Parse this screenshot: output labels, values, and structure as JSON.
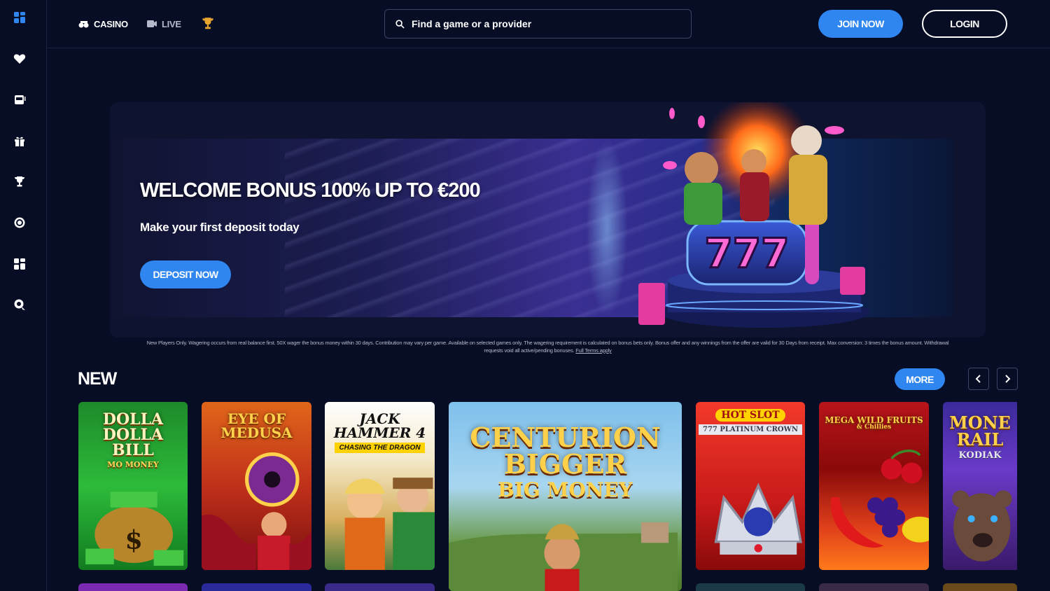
{
  "sidebar": {
    "items": [
      {
        "name": "sidebar-item-lobby",
        "icon": "grid-icon"
      },
      {
        "name": "sidebar-item-favorites",
        "icon": "heart-icon"
      },
      {
        "name": "sidebar-item-slots",
        "icon": "slot-machine-icon"
      },
      {
        "name": "sidebar-item-promotions",
        "icon": "gift-icon"
      },
      {
        "name": "sidebar-item-tournaments",
        "icon": "trophy-icon"
      },
      {
        "name": "sidebar-item-roulette",
        "icon": "roulette-icon"
      },
      {
        "name": "sidebar-item-categories",
        "icon": "grid-icon"
      },
      {
        "name": "sidebar-item-support",
        "icon": "chat-icon"
      }
    ]
  },
  "header": {
    "nav": {
      "casino": "CASINO",
      "live": "LIVE"
    },
    "search_placeholder": "Find a game or a provider",
    "join_label": "JOIN NOW",
    "login_label": "LOGIN"
  },
  "banner": {
    "title": "WELCOME BONUS 100% UP TO €200",
    "subtitle": "Make your first deposit today",
    "cta": "DEPOSIT NOW",
    "art_text": "777"
  },
  "disclaimer": {
    "text": "New Players Only. Wagering occurs from real balance first. 50X wager the bonus money within 30 days. Contribution may vary per game. Available on selected games only. The wagering requirement is calculated on bonus bets only. Bonus offer and any winnings from the offer are valid for 30 Days from receipt. Max conversion: 3 times the bonus amount. Withdrawal requests void all active/pending bonuses.",
    "link": "Full Terms apply"
  },
  "new_section": {
    "title": "NEW",
    "more_label": "MORE",
    "games": [
      {
        "title": "DOLLA DOLLA BILL",
        "subtitle": "MO MONEY"
      },
      {
        "title": "EYE OF MEDUSA",
        "subtitle": ""
      },
      {
        "title": "JACK HAMMER 4",
        "subtitle": "CHASING THE DRAGON"
      },
      {
        "title": "CENTURION BIGGER",
        "subtitle": "BIG MONEY"
      },
      {
        "title": "HOT SLOT",
        "subtitle": "777 PLATINUM CROWN"
      },
      {
        "title": "MEGA WILD FRUITS",
        "subtitle": "& Chillies"
      },
      {
        "title": "MONE RAIL",
        "subtitle": "KODIAK"
      }
    ]
  },
  "colors": {
    "background": "#070d24",
    "accent": "#2f86f0",
    "border": "#3b4566"
  }
}
